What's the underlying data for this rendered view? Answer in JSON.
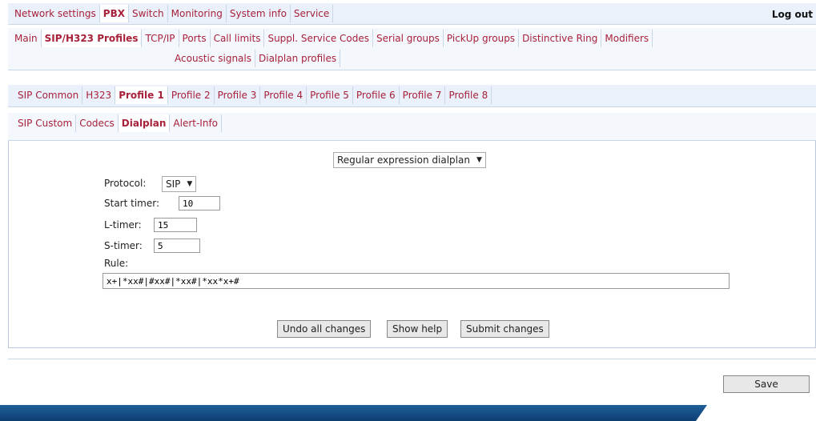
{
  "top_nav": {
    "tabs": [
      "Network settings",
      "PBX",
      "Switch",
      "Monitoring",
      "System info",
      "Service"
    ],
    "active": "PBX",
    "logout": "Log out"
  },
  "pbx_tabs": {
    "row1": [
      "Main",
      "SIP/H323 Profiles",
      "TCP/IP",
      "Ports",
      "Call limits",
      "Suppl. Service Codes",
      "Serial groups",
      "PickUp groups",
      "Distinctive Ring",
      "Modifiers"
    ],
    "row2": [
      "Acoustic signals",
      "Dialplan profiles"
    ],
    "active": "SIP/H323 Profiles"
  },
  "profile_tabs": {
    "items": [
      "SIP Common",
      "H323",
      "Profile 1",
      "Profile 2",
      "Profile 3",
      "Profile 4",
      "Profile 5",
      "Profile 6",
      "Profile 7",
      "Profile 8"
    ],
    "active": "Profile 1"
  },
  "sub_tabs": {
    "items": [
      "SIP Custom",
      "Codecs",
      "Dialplan",
      "Alert-Info"
    ],
    "active": "Dialplan"
  },
  "dialplan": {
    "mode_select": "Regular expression dialplan",
    "protocol_label": "Protocol:",
    "protocol_value": "SIP",
    "start_timer_label": "Start timer:",
    "start_timer_value": "10",
    "l_timer_label": "L-timer:",
    "l_timer_value": "15",
    "s_timer_label": "S-timer:",
    "s_timer_value": "5",
    "rule_label": "Rule:",
    "rule_value": "x+|*xx#|#xx#|*xx#|*xx*x+#"
  },
  "buttons": {
    "undo": "Undo all changes",
    "help": "Show help",
    "submit": "Submit changes",
    "save": "Save"
  }
}
